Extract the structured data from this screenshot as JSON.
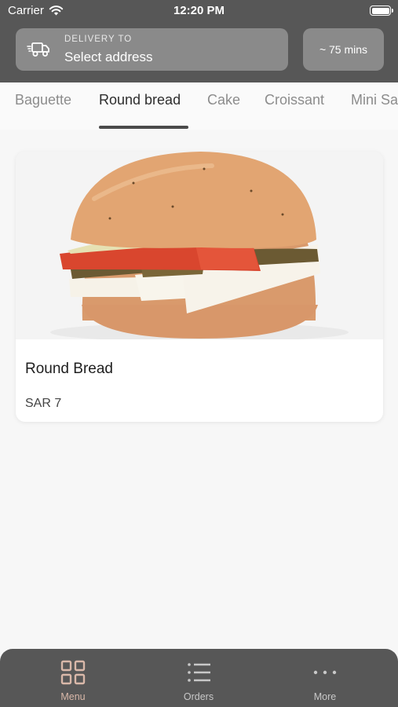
{
  "status_bar": {
    "carrier": "Carrier",
    "time": "12:20 PM"
  },
  "header": {
    "delivery_caption": "DELIVERY TO",
    "address_value": "Select address",
    "eta": "~ 75 mins"
  },
  "tabs": [
    {
      "label": "Baguette",
      "active": false
    },
    {
      "label": "Round bread",
      "active": true
    },
    {
      "label": "Cake",
      "active": false
    },
    {
      "label": "Croissant",
      "active": false
    },
    {
      "label": "Mini Sa",
      "active": false
    }
  ],
  "products": [
    {
      "name": "Round Bread",
      "price": "SAR 7",
      "image": "round-bread-sandwich"
    }
  ],
  "bottom_nav": [
    {
      "label": "Menu",
      "icon": "grid-icon",
      "active": true
    },
    {
      "label": "Orders",
      "icon": "list-icon",
      "active": false
    },
    {
      "label": "More",
      "icon": "more-dots-icon",
      "active": false
    }
  ],
  "colors": {
    "header": "#575757",
    "accent": "#d9b8a9",
    "tile": "#8a8a8a"
  }
}
